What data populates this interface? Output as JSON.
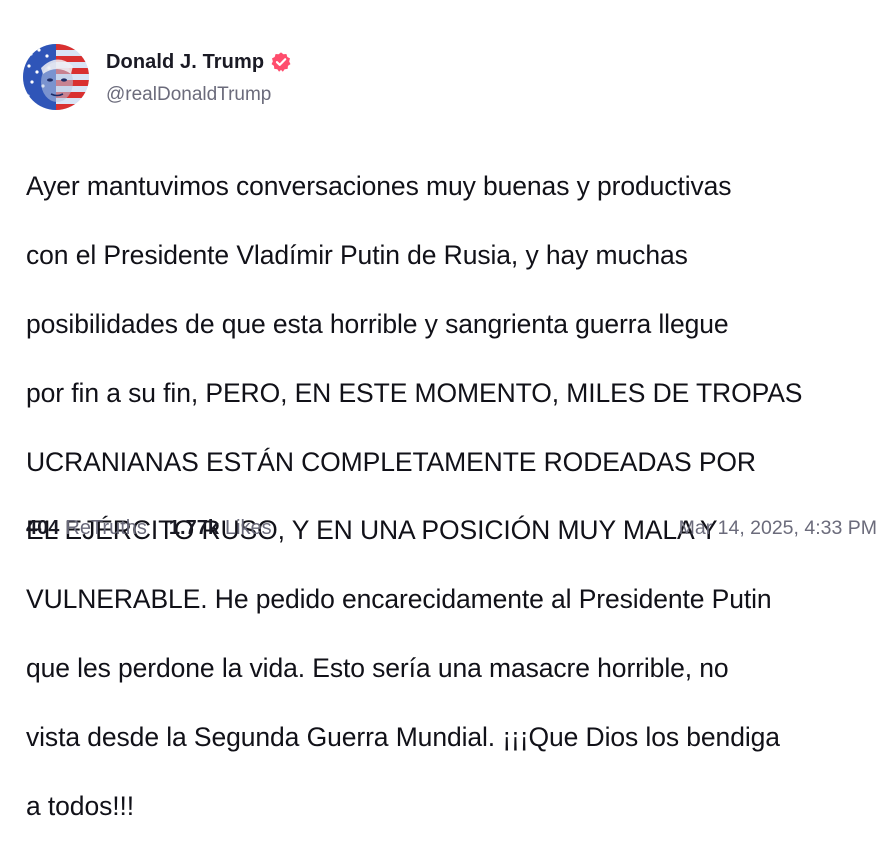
{
  "author": {
    "display_name": "Donald J. Trump",
    "handle": "@realDonaldTrump",
    "verified_icon": "verified-badge-icon",
    "verified_color": "#ff4d6d",
    "avatar": "profile-avatar"
  },
  "post": {
    "lines": [
      "Ayer mantuvimos conversaciones muy buenas y productivas",
      "con el Presidente Vladímir Putin de Rusia, y hay muchas",
      "posibilidades de que esta horrible y sangrienta guerra llegue",
      "por fin a su fin, PERO, EN ESTE MOMENTO, MILES DE TROPAS",
      "UCRANIANAS ESTÁN COMPLETAMENTE RODEADAS POR",
      "EL EJÉRCITO RUSO, Y EN UNA POSICIÓN MUY MALA Y",
      "VULNERABLE. He pedido encarecidamente al Presidente Putin",
      "que les perdone la vida. Esto sería una masacre horrible, no",
      "vista desde la Segunda Guerra Mundial. ¡¡¡Que Dios los bendiga",
      "a todos!!!"
    ]
  },
  "stats": {
    "retruths_count": "404",
    "retruths_label": "ReTruths",
    "likes_count": "1.77k",
    "likes_label": "Likes"
  },
  "timestamp": "Mar 14, 2025, 4:33 PM"
}
